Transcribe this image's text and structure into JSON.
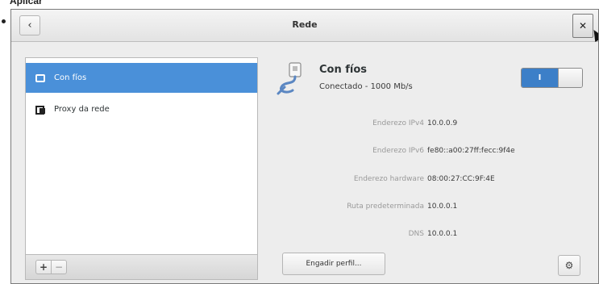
{
  "caption": "Aplicar",
  "window": {
    "title": "Rede",
    "back_glyph": "‹",
    "close_glyph": "✕"
  },
  "sidebar": {
    "items": [
      {
        "label": "Con fíos",
        "icon": "network-icon",
        "selected": true
      },
      {
        "label": "Proxy da rede",
        "icon": "proxy-icon",
        "selected": false
      }
    ],
    "add_glyph": "+",
    "remove_glyph": "−"
  },
  "connection": {
    "name": "Con fíos",
    "status": "Conectado - 1000 Mb/s",
    "enabled": true,
    "toggle_on_glyph": "I",
    "details": [
      {
        "label": "Enderezo IPv4",
        "value": "10.0.0.9"
      },
      {
        "label": "Enderezo IPv6",
        "value": "fe80::a00:27ff:fecc:9f4e"
      },
      {
        "label": "Enderezo hardware",
        "value": "08:00:27:CC:9F:4E"
      },
      {
        "label": "Ruta predeterminada",
        "value": "10.0.0.1"
      },
      {
        "label": "DNS",
        "value": "10.0.0.1"
      }
    ]
  },
  "actions": {
    "add_profile_label": "Engadir perfil...",
    "settings_glyph": "⚙"
  },
  "colors": {
    "accent": "#4a90d9",
    "toggle_on": "#3c7fc8"
  }
}
